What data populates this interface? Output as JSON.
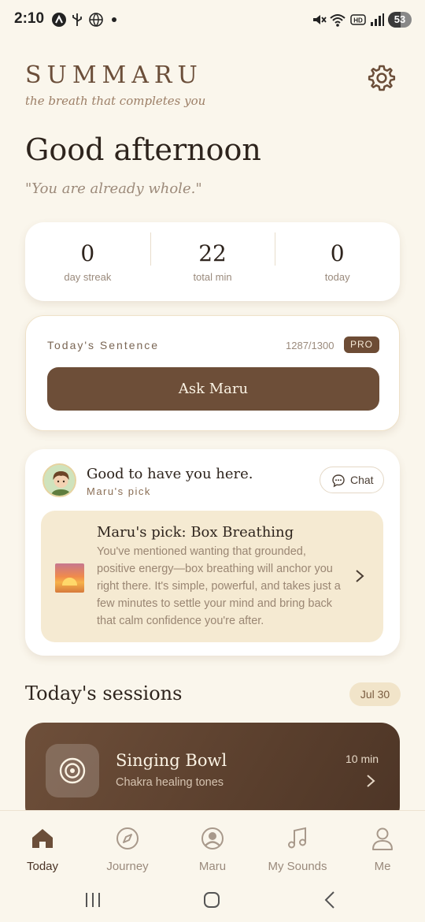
{
  "status_bar": {
    "time": "2:10",
    "battery": "53",
    "battery_level": 0.53,
    "icons": [
      "a-icon",
      "usb-icon",
      "globe-icon",
      "dot",
      "mute-icon",
      "wifi-icon",
      "hd-icon",
      "signal-icon",
      "battery-icon"
    ]
  },
  "header": {
    "brand": "SUMMARU",
    "tagline": "the breath that completes you",
    "settings_icon": "gear-icon"
  },
  "greeting": "Good afternoon",
  "quote": "\"You are already whole.\"",
  "stats": [
    {
      "value": "0",
      "label": "day streak"
    },
    {
      "value": "22",
      "label": "total min"
    },
    {
      "value": "0",
      "label": "today"
    }
  ],
  "sentence": {
    "title": "Today's Sentence",
    "count": "1287/1300",
    "badge": "PRO",
    "button": "Ask Maru"
  },
  "maru": {
    "greeting": "Good to have you here.",
    "subtitle": "Maru's pick",
    "chat_label": "Chat",
    "pick_title": "Maru's pick: Box Breathing",
    "pick_text": "You've mentioned wanting that grounded, positive energy—box breathing will anchor you right there. It's simple, powerful, and takes just a few minutes to settle your mind and bring back that calm confidence you're after."
  },
  "sessions": {
    "title": "Today's sessions",
    "date": "Jul 30",
    "items": [
      {
        "name": "Singing Bowl",
        "desc": "Chakra healing tones",
        "duration": "10 min"
      }
    ]
  },
  "nav": {
    "items": [
      {
        "label": "Today",
        "icon": "home-icon",
        "active": true
      },
      {
        "label": "Journey",
        "icon": "compass-icon",
        "active": false
      },
      {
        "label": "Maru",
        "icon": "user-circle-icon",
        "active": false
      },
      {
        "label": "My Sounds",
        "icon": "music-icon",
        "active": false
      },
      {
        "label": "Me",
        "icon": "person-icon",
        "active": false
      }
    ]
  },
  "colors": {
    "background": "#faf6ec",
    "accent": "#6d4e38",
    "badge": "#6d4c35",
    "pick_bg": "#f5ead2"
  }
}
